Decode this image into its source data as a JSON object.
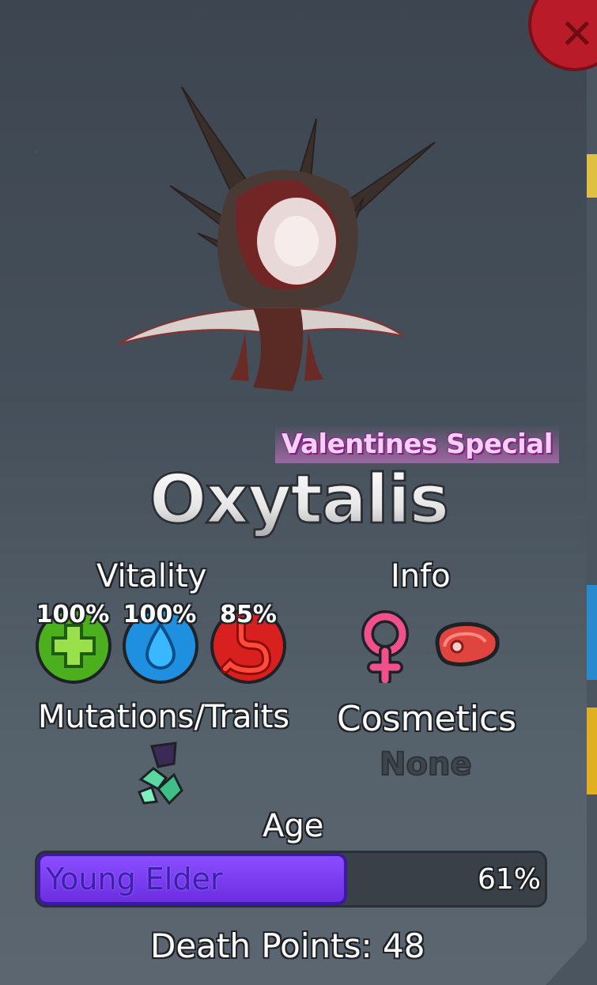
{
  "creature": {
    "badge": "Valentines Special",
    "name": "Oxytalis"
  },
  "sections": {
    "vitality_label": "Vitality",
    "info_label": "Info",
    "mutations_label": "Mutations/Traits",
    "cosmetics_label": "Cosmetics"
  },
  "vitality": [
    {
      "stat": "health",
      "value": "100%",
      "icon": "health-cross-icon",
      "color": "#4caf1e"
    },
    {
      "stat": "water",
      "value": "100%",
      "icon": "water-drop-icon",
      "color": "#1f8fe0"
    },
    {
      "stat": "hunger",
      "value": "85%",
      "icon": "stomach-icon",
      "color": "#d8201e"
    }
  ],
  "info_icons": [
    "female-symbol-icon",
    "meat-diet-icon"
  ],
  "mutations_icons": [
    "crystal-mutation-icon"
  ],
  "cosmetics": {
    "value": "None"
  },
  "age": {
    "label": "Age",
    "stage": "Young Elder",
    "progress_percent": 61,
    "progress_text": "61%"
  },
  "death_points": {
    "text": "Death Points: 48"
  },
  "colors": {
    "age_fill": "#7b3cf5",
    "badge": "#f5d0f5",
    "close_button": "#b91c28"
  }
}
